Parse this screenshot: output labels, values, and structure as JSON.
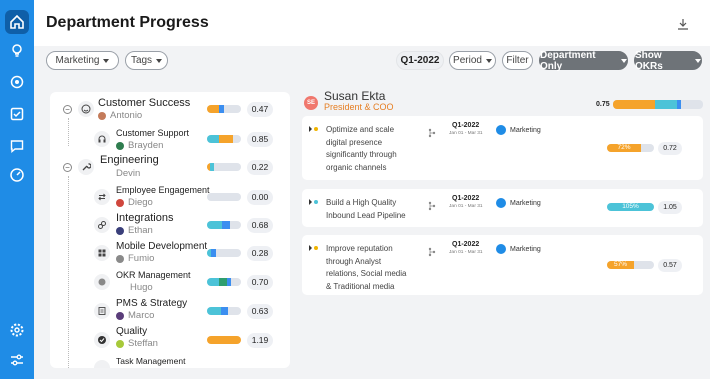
{
  "page": {
    "title": "Department Progress"
  },
  "sidebar": {
    "icons": [
      "home-icon",
      "lightbulb-icon",
      "target-icon",
      "checklist-icon",
      "chat-icon",
      "dashboard-icon",
      "settings-icon",
      "sliders-icon"
    ]
  },
  "filters": {
    "department": "Marketing",
    "tags": "Tags",
    "quarter": "Q1-2022",
    "period": "Period",
    "filter": "Filter",
    "dept_only": "Department Only",
    "show_okrs": "Show OKRs"
  },
  "colors": {
    "accent": "#1f8ce6",
    "orange": "#f5a32b",
    "teal": "#4cc3d8",
    "blue": "#3b8ef0",
    "track": "#dfe3ea"
  },
  "tree": [
    {
      "title": "Customer Success",
      "owner": "Antonio",
      "value": "0.47",
      "level": 0,
      "progress": 0.47
    },
    {
      "title": "Customer Support",
      "owner": "Brayden",
      "value": "0.85",
      "level": 1,
      "progress": 0.85
    },
    {
      "title": "Engineering",
      "owner": "Devin",
      "value": "0.22",
      "level": 0,
      "progress": 0.22
    },
    {
      "title": "Employee Engagement",
      "owner": "Diego",
      "value": "0.00",
      "level": 1,
      "progress": 0
    },
    {
      "title": "Integrations",
      "owner": "Ethan",
      "value": "0.68",
      "level": 1,
      "progress": 0.68
    },
    {
      "title": "Mobile Development",
      "owner": "Fumio",
      "value": "0.28",
      "level": 1,
      "progress": 0.28
    },
    {
      "title": "OKR Management",
      "owner": "Hugo",
      "value": "0.70",
      "level": 1,
      "progress": 0.7
    },
    {
      "title": "PMS & Strategy",
      "owner": "Marco",
      "value": "0.63",
      "level": 1,
      "progress": 0.63
    },
    {
      "title": "Quality",
      "owner": "Steffan",
      "value": "1.19",
      "level": 1,
      "progress": 1.0
    },
    {
      "title": "Task Management",
      "owner": "",
      "value": "",
      "level": 1,
      "progress": 0
    }
  ],
  "detail": {
    "name": "Susan Ekta",
    "initials": "SE",
    "role": "President & COO",
    "score": "0.75",
    "score_progress": 0.75,
    "objectives": [
      {
        "text": "Optimize and scale digital presence significantly through organic channels",
        "period": "Q1-2022",
        "dates": "Jan 01 - Mar 31",
        "team": "Marketing",
        "percent": "72%",
        "progress": 0.72,
        "value": "0.72",
        "color": "#f5a32b"
      },
      {
        "text": "Build a High Quality Inbound Lead Pipeline",
        "period": "Q1-2022",
        "dates": "Jan 01 - Mar 31",
        "team": "Marketing",
        "percent": "105%",
        "progress": 1.0,
        "value": "1.05",
        "color": "#4cc3d8"
      },
      {
        "text": "Improve reputation through Analyst relations, Social media & Traditional media",
        "period": "Q1-2022",
        "dates": "Jan 01 - Mar 31",
        "team": "Marketing",
        "percent": "57%",
        "progress": 0.57,
        "value": "0.57",
        "color": "#f5a32b"
      }
    ]
  }
}
